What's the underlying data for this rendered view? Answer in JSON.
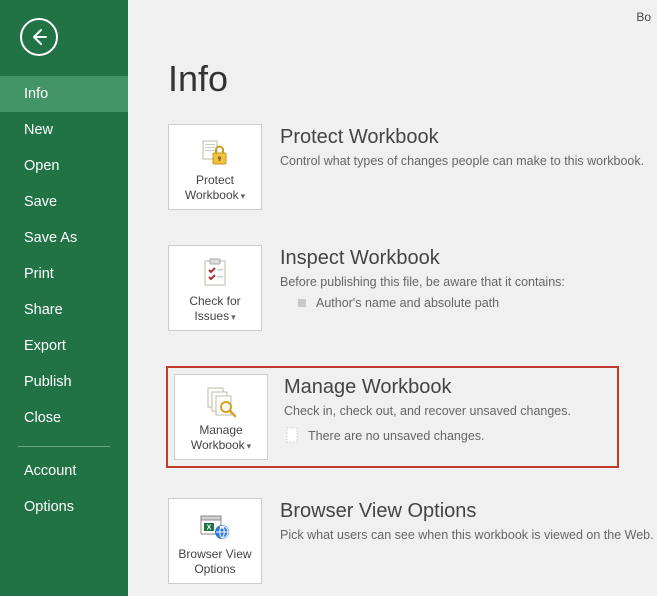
{
  "topright": "Bo",
  "nav": {
    "items": [
      {
        "label": "Info",
        "selected": true
      },
      {
        "label": "New"
      },
      {
        "label": "Open"
      },
      {
        "label": "Save"
      },
      {
        "label": "Save As"
      },
      {
        "label": "Print"
      },
      {
        "label": "Share"
      },
      {
        "label": "Export"
      },
      {
        "label": "Publish"
      },
      {
        "label": "Close"
      }
    ],
    "footerItems": [
      {
        "label": "Account"
      },
      {
        "label": "Options"
      }
    ]
  },
  "page": {
    "title": "Info"
  },
  "sections": {
    "protect": {
      "tileLabel": "Protect Workbook",
      "title": "Protect Workbook",
      "desc": "Control what types of changes people can make to this workbook."
    },
    "inspect": {
      "tileLabel": "Check for Issues",
      "title": "Inspect Workbook",
      "desc": "Before publishing this file, be aware that it contains:",
      "bullet": "Author's name and absolute path"
    },
    "manage": {
      "tileLabel": "Manage Workbook",
      "title": "Manage Workbook",
      "desc": "Check in, check out, and recover unsaved changes.",
      "status": "There are no unsaved changes."
    },
    "browser": {
      "tileLabel": "Browser View Options",
      "title": "Browser View Options",
      "desc": "Pick what users can see when this workbook is viewed on the Web."
    }
  }
}
